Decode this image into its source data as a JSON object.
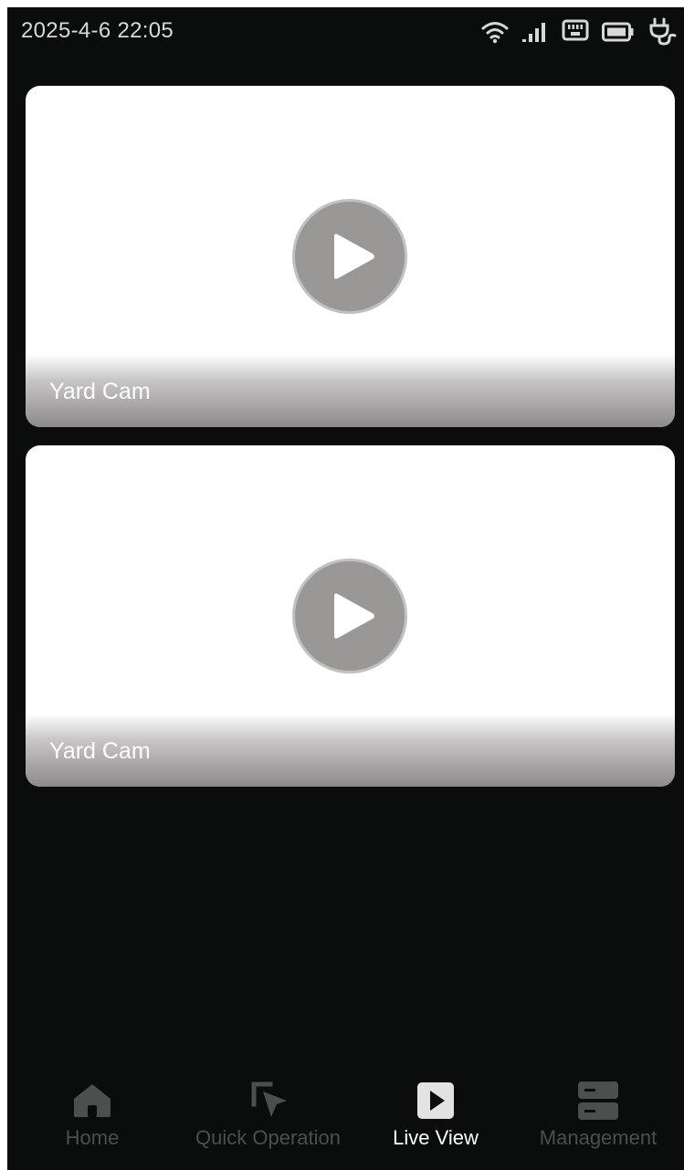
{
  "status_bar": {
    "datetime": "2025-4-6 22:05",
    "icons": [
      "wifi-icon",
      "cellular-signal-icon",
      "ethernet-icon",
      "battery-icon",
      "power-plug-icon"
    ]
  },
  "cameras": [
    {
      "label": "Yard Cam",
      "icon": "play-icon"
    },
    {
      "label": "Yard Cam",
      "icon": "play-icon"
    }
  ],
  "nav": {
    "items": [
      {
        "label": "Home",
        "icon": "home-icon",
        "active": false
      },
      {
        "label": "Quick Operation",
        "icon": "cursor-click-icon",
        "active": false
      },
      {
        "label": "Live View",
        "icon": "play-square-icon",
        "active": true
      },
      {
        "label": "Management",
        "icon": "server-icon",
        "active": false
      }
    ]
  },
  "colors": {
    "background": "#0b0c0c",
    "active_label": "#ffffff",
    "inactive_label": "#4d4f4f",
    "play_button": "#9a9797"
  }
}
